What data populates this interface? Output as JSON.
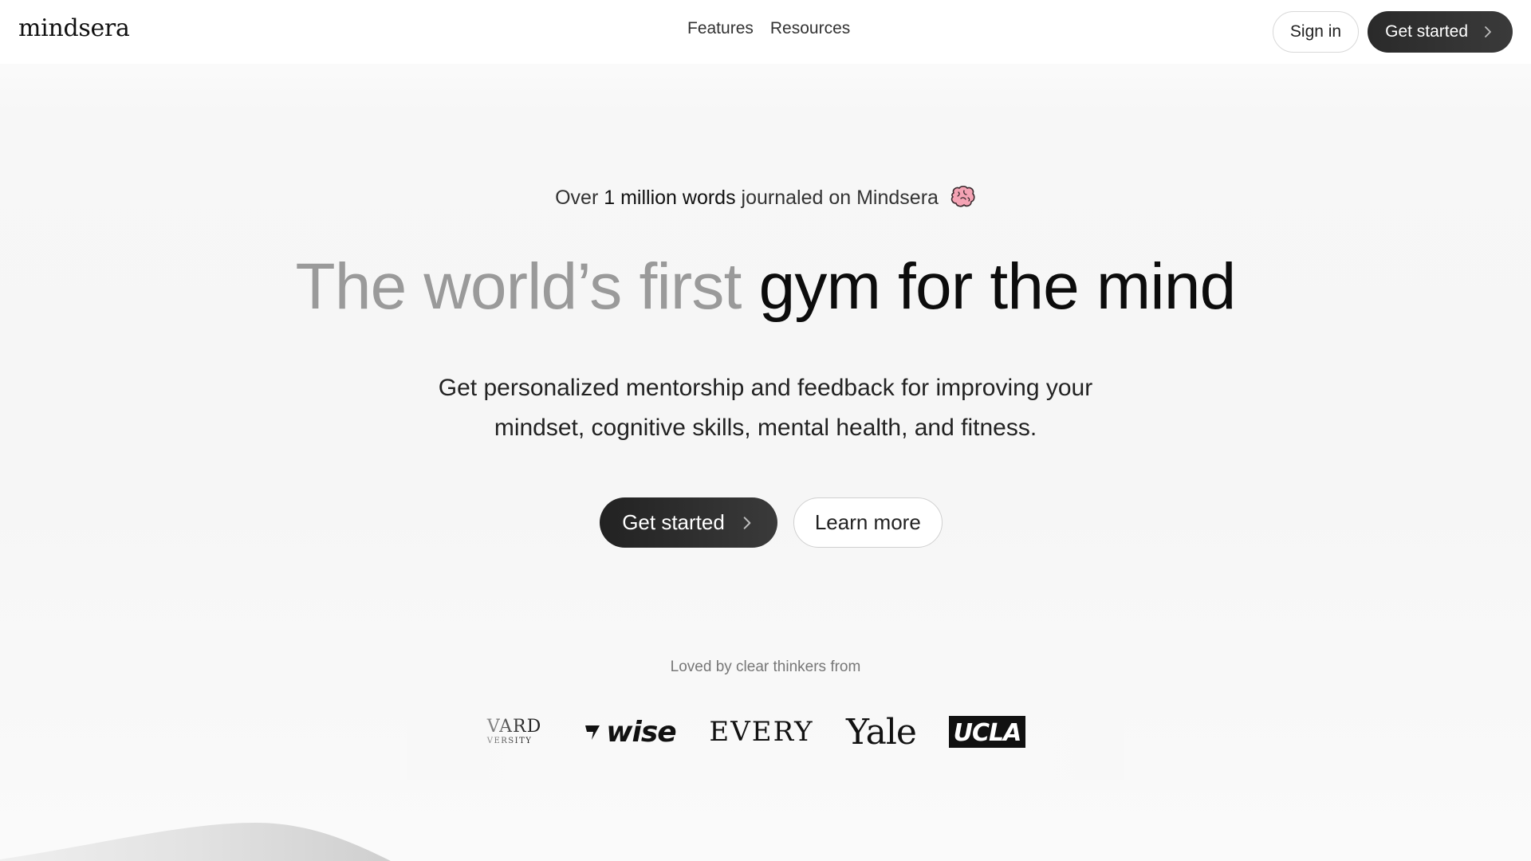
{
  "brand": {
    "name": "mindsera"
  },
  "nav": {
    "links": [
      {
        "label": "Features"
      },
      {
        "label": "Resources"
      }
    ],
    "sign_in": "Sign in",
    "get_started": "Get started"
  },
  "hero": {
    "kicker_prefix": "Over",
    "kicker_strong": "1 million words",
    "kicker_suffix": "journaled on Mindsera",
    "kicker_icon": "brain-icon",
    "headline_muted": "The world’s first",
    "headline_bold": "gym for the mind",
    "sub_line1": "Get personalized mentorship and feedback for improving your",
    "sub_line2": "mindset, cognitive skills, mental health, and fitness.",
    "primary_cta": "Get started",
    "secondary_cta": "Learn more"
  },
  "social_proof": {
    "title": "Loved by clear thinkers from",
    "logos": {
      "harvard_line1": "VARD",
      "harvard_line2": "VERSITY",
      "wise": "wise",
      "every": "EVERY",
      "yale": "Yale",
      "ucla": "UCLA"
    }
  },
  "colors": {
    "accent_dark": "#2a2a2a",
    "muted_text": "#9a9a9a",
    "brain_pink": "#f4a3b4"
  }
}
